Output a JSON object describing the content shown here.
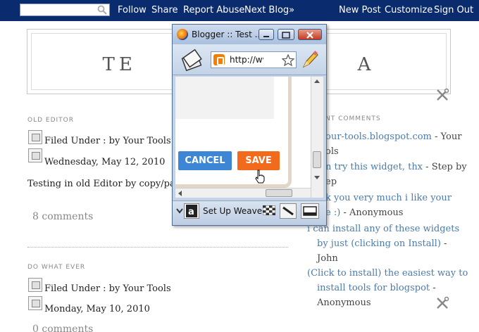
{
  "navbar": {
    "search_value": "",
    "follow": "Follow",
    "share": "Share",
    "report_abuse": "Report Abuse",
    "next_blog": "Next Blog»",
    "new_post": "New Post",
    "customize": "Customize",
    "sign_out": "Sign Out"
  },
  "header": {
    "title_visible": "TE                      A"
  },
  "posts": [
    {
      "date": "OLD EDITOR",
      "filed_under": "Filed Under : by Your Tools",
      "date_line": "Wednesday, May 12, 2010",
      "body": "Testing in old Editor by copy/paste r",
      "comments": "8 comments"
    },
    {
      "date": "DO WHAT EVER",
      "filed_under": "Filed Under : by Your Tools",
      "date_line": "Monday, May 10, 2010",
      "comments": "0 comments"
    }
  ],
  "sidebar": {
    "heading": "NT COMMENTS",
    "comments": [
      {
        "lines": [
          "our-tools.blogspot.com",
          " - Your",
          "ols"
        ]
      },
      {
        "lines": [
          "n try this widget, thx",
          " - Step by",
          "ep"
        ]
      },
      {
        "lines": [
          "k you very much i like your",
          "e :)",
          " - Anonymous"
        ]
      },
      {
        "lines": [
          "i can install any of these widgets",
          "by just (clicking on Install)",
          " -",
          "John"
        ]
      },
      {
        "lines": [
          "(Click to install) the easiest way to",
          "install tools for blogspot",
          " -",
          "Anonymous"
        ]
      }
    ]
  },
  "popup": {
    "title": "Blogger :: Test ...",
    "url": "http://www.blogger.com",
    "cancel": "CANCEL",
    "save": "SAVE",
    "status": "Set Up Weave..."
  },
  "colors": {
    "navbar": "#0a2b6e",
    "link": "#4b7bab",
    "save": "#f26b1d",
    "cancel": "#3d86d6"
  }
}
